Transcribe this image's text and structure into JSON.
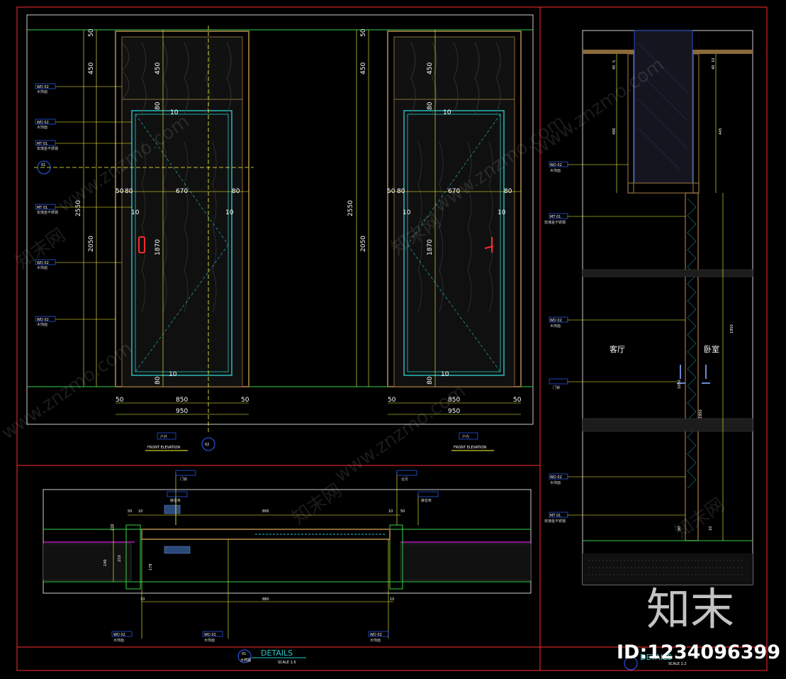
{
  "watermark": {
    "brand": "知末",
    "id_text": "ID:1234096399",
    "site_text": "www.znzmo.com",
    "cn_text": "知末网"
  },
  "elevation_left": {
    "dims_top": [
      "50",
      "450",
      "2550",
      "2050"
    ],
    "dims_inner": [
      "450",
      "80",
      "1870",
      "80"
    ],
    "widths": [
      "50",
      "80",
      "670",
      "80",
      "10",
      "10",
      "10",
      "10"
    ],
    "bottom": [
      "50",
      "850",
      "50",
      "950"
    ],
    "title_cn": "户外",
    "title_en": "FRONT ELEVATION",
    "marker": "01",
    "marker_b": "02"
  },
  "elevation_right": {
    "dims_left": [
      "50",
      "450",
      "2550",
      "2050"
    ],
    "dims_inner": [
      "450",
      "80",
      "1870",
      "80"
    ],
    "widths": [
      "50",
      "80",
      "670",
      "80",
      "10",
      "10",
      "10",
      "10"
    ],
    "bottom": [
      "50",
      "850",
      "50",
      "950"
    ],
    "title_cn": "户内",
    "title_en": "FRONT ELEVATION"
  },
  "legend_tags": [
    {
      "code": "WD  02",
      "desc": "木饰面"
    },
    {
      "code": "WD  02",
      "desc": "木饰面"
    },
    {
      "code": "MT  01",
      "desc": "玫瑰金不锈钢"
    },
    {
      "code": "MT  01",
      "desc": "玫瑰金不锈钢"
    },
    {
      "code": "WD  02",
      "desc": "木饰面"
    },
    {
      "code": "WD  02",
      "desc": "木饰面"
    }
  ],
  "section": {
    "tags": [
      {
        "code": "WD  02",
        "desc": "木饰面"
      },
      {
        "code": "MT  01",
        "desc": "玫瑰金不锈钢"
      },
      {
        "code": "WD  02",
        "desc": "木饰面"
      },
      {
        "code": "",
        "desc": "门锁"
      },
      {
        "code": "WD  02",
        "desc": "木饰面"
      },
      {
        "code": "MT  01",
        "desc": "玫瑰金不锈钢"
      }
    ],
    "room_left": "客厅",
    "room_right": "卧室",
    "dims": [
      "5",
      "45",
      "490",
      "10",
      "40",
      "445",
      "1950",
      "1050",
      "1950",
      "80",
      "10"
    ],
    "title": "DETAILS",
    "scale": "SCALE 1:2"
  },
  "plan": {
    "tags_top": [
      {
        "code": "",
        "desc": "门锁"
      },
      {
        "code": "",
        "desc": "静音条"
      },
      {
        "code": "",
        "desc": "合页"
      },
      {
        "code": "",
        "desc": "静音条"
      }
    ],
    "tags_bottom": [
      {
        "code": "WD  02",
        "desc": "木饰面"
      },
      {
        "code": "WD  02",
        "desc": "木饰面"
      },
      {
        "code": "WD  02",
        "desc": "木饰面"
      }
    ],
    "dims": [
      "50",
      "10",
      "895",
      "10",
      "50",
      "270",
      "140",
      "210",
      "178",
      "880",
      "10",
      "10"
    ],
    "title": "DETAILS",
    "title_cn": "大样图",
    "scale": "SCALE 1:5",
    "marker": "01"
  },
  "colors": {
    "frame_red": "#ff2b2b",
    "green": "#35d04a",
    "yellow": "#ffff33",
    "cyan": "#2bc8c8",
    "wood": "#8a6a3a",
    "magenta": "#e020e0",
    "blue": "#3060ff"
  }
}
